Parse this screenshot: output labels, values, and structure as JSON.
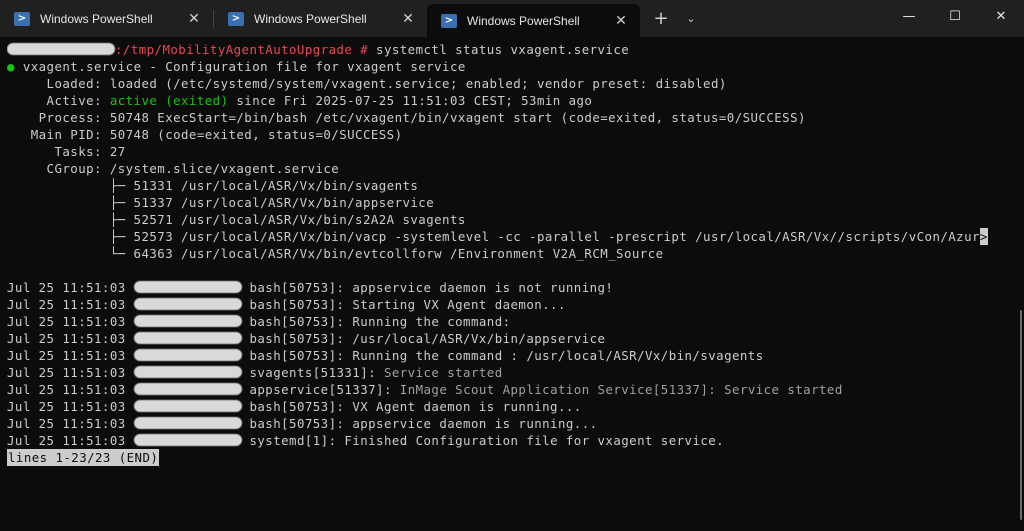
{
  "tabs": [
    {
      "label": "Windows PowerShell",
      "close": "✕"
    },
    {
      "label": "Windows PowerShell",
      "close": "✕"
    },
    {
      "label": "Windows PowerShell",
      "close": "✕"
    }
  ],
  "tab_bar": {
    "new_tab": "+",
    "dropdown": "⌄"
  },
  "window": {
    "minimize": "—",
    "maximize": "☐",
    "close": "✕"
  },
  "terminal": {
    "prompt_path": ":/tmp/MobilityAgentAutoUpgrade #",
    "command": " systemctl status vxagent.service",
    "service_dot": "●",
    "service_title": " vxagent.service - Configuration file for vxagent service",
    "loaded": "     Loaded: loaded (/etc/systemd/system/vxagent.service; enabled; vendor preset: disabled)",
    "active_label": "     Active: ",
    "active_state": "active (exited)",
    "active_since": " since Fri 2025-07-25 11:51:03 CEST; 53min ago",
    "process": "    Process: 50748 ExecStart=/bin/bash /etc/vxagent/bin/vxagent start (code=exited, status=0/SUCCESS)",
    "main_pid": "   Main PID: 50748 (code=exited, status=0/SUCCESS)",
    "tasks": "      Tasks: 27",
    "cgroup": "     CGroup: /system.slice/vxagent.service",
    "cgroup_tree": [
      "             ├─ 51331 /usr/local/ASR/Vx/bin/svagents",
      "             ├─ 51337 /usr/local/ASR/Vx/bin/appservice",
      "             ├─ 52571 /usr/local/ASR/Vx/bin/s2A2A svagents",
      "             ├─ 52573 /usr/local/ASR/Vx/bin/vacp -systemlevel -cc -parallel -prescript /usr/local/ASR/Vx//scripts/vCon/Azur",
      "             └─ 64363 /usr/local/ASR/Vx/bin/evtcollforw /Environment V2A_RCM_Source"
    ],
    "truncation_marker": ">",
    "log": [
      {
        "ts": "Jul 25 11:51:03 ",
        "src": "bash[50753]:",
        "msg": " appservice daemon is not running!",
        "dim": false
      },
      {
        "ts": "Jul 25 11:51:03 ",
        "src": "bash[50753]:",
        "msg": " Starting VX Agent daemon...",
        "dim": false
      },
      {
        "ts": "Jul 25 11:51:03 ",
        "src": "bash[50753]:",
        "msg": " Running the command:",
        "dim": false
      },
      {
        "ts": "Jul 25 11:51:03 ",
        "src": "bash[50753]:",
        "msg": " /usr/local/ASR/Vx/bin/appservice",
        "dim": false
      },
      {
        "ts": "Jul 25 11:51:03 ",
        "src": "bash[50753]:",
        "msg": " Running the command : /usr/local/ASR/Vx/bin/svagents",
        "dim": false
      },
      {
        "ts": "Jul 25 11:51:03 ",
        "src": "svagents[51331]:",
        "msg": " Service started",
        "dim": true
      },
      {
        "ts": "Jul 25 11:51:03 ",
        "src": "appservice[51337]:",
        "msg": " InMage Scout Application Service[51337]: Service started",
        "dim": true
      },
      {
        "ts": "Jul 25 11:51:03 ",
        "src": "bash[50753]:",
        "msg": " VX Agent daemon is running...",
        "dim": false
      },
      {
        "ts": "Jul 25 11:51:03 ",
        "src": "bash[50753]:",
        "msg": " appservice daemon is running...",
        "dim": false
      },
      {
        "ts": "Jul 25 11:51:03 ",
        "src": "systemd[1]:",
        "msg": " Finished Configuration file for vxagent service.",
        "dim": false
      }
    ],
    "pager_status": "lines 1-23/23 (END)"
  }
}
